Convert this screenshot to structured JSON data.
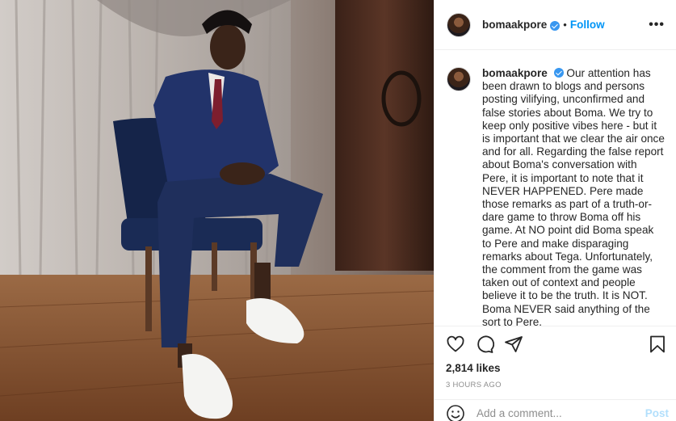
{
  "photo": {
    "alt_subject": "man in navy suit seated in a chair",
    "colors": {
      "wall": "#a99e96",
      "floor": "#8a5534",
      "suit": "#1f2f5c",
      "curtain": "#c9c3bf",
      "cabinet": "#4a2b1e"
    }
  },
  "header": {
    "username": "bomaakpore",
    "verified_icon": "verified-badge-icon",
    "separator": "•",
    "follow_label": "Follow",
    "more_icon": "•••"
  },
  "caption": {
    "username": "bomaakpore",
    "text": "Our attention has been drawn to blogs and persons posting vilifying, unconfirmed and false stories about Boma. We try to keep only positive vibes here - but it is important that we clear the air once and for all. Regarding the false report about Boma's conversation with Pere, it is important to note that it NEVER HAPPENED. Pere made those remarks as part of a truth-or-dare game to throw Boma off his game. At NO point did Boma speak to Pere and make disparaging remarks about Tega. Unfortunately, the comment from the game was taken out of context and people believe it to be the truth. It is NOT. Boma NEVER said anything of the sort to Pere."
  },
  "actions": {
    "icons": [
      "heart-icon",
      "comment-icon",
      "share-icon",
      "bookmark-icon"
    ],
    "likes": "2,814 likes",
    "timestamp": "3 HOURS AGO"
  },
  "comment_box": {
    "placeholder": "Add a comment...",
    "post_label": "Post",
    "emoji_icon": "smiley-icon"
  },
  "colors": {
    "accent": "#0095f6",
    "verified": "#3897f0",
    "muted": "#8e8e8e",
    "post_disabled": "#b2dffc"
  }
}
